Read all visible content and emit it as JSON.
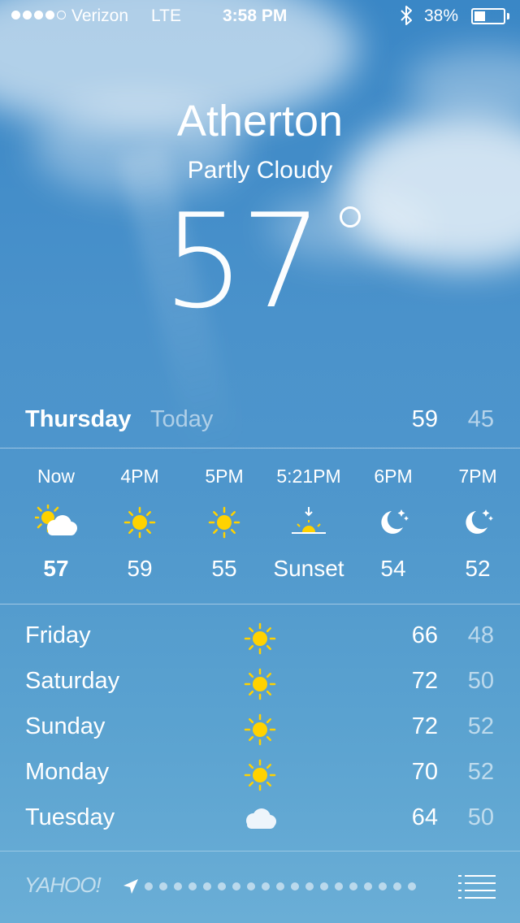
{
  "status_bar": {
    "carrier": "Verizon",
    "network": "LTE",
    "time": "3:58 PM",
    "battery_percent": "38%",
    "battery_level": 0.38,
    "signal_bars_filled": 4,
    "signal_bars_total": 5,
    "bluetooth_icon": "bluetooth-icon"
  },
  "current": {
    "city": "Atherton",
    "condition": "Partly Cloudy",
    "temperature": "57"
  },
  "today": {
    "day": "Thursday",
    "label": "Today",
    "high": "59",
    "low": "45"
  },
  "hourly": [
    {
      "time": "Now",
      "icon": "partly-cloudy-day-icon",
      "temp": "57"
    },
    {
      "time": "4PM",
      "icon": "sunny-icon",
      "temp": "59"
    },
    {
      "time": "5PM",
      "icon": "sunny-icon",
      "temp": "55"
    },
    {
      "time": "5:21PM",
      "icon": "sunset-icon",
      "temp": "Sunset"
    },
    {
      "time": "6PM",
      "icon": "clear-night-icon",
      "temp": "54"
    },
    {
      "time": "7PM",
      "icon": "clear-night-icon",
      "temp": "52"
    }
  ],
  "daily": [
    {
      "day": "Friday",
      "icon": "sunny-icon",
      "high": "66",
      "low": "48"
    },
    {
      "day": "Saturday",
      "icon": "sunny-icon",
      "high": "72",
      "low": "50"
    },
    {
      "day": "Sunday",
      "icon": "sunny-icon",
      "high": "72",
      "low": "52"
    },
    {
      "day": "Monday",
      "icon": "sunny-icon",
      "high": "70",
      "low": "52"
    },
    {
      "day": "Tuesday",
      "icon": "cloudy-icon",
      "high": "64",
      "low": "50"
    }
  ],
  "footer": {
    "brand": "YAHOO!",
    "page_count": 19,
    "location_icon": "location-arrow-icon",
    "list_icon": "list-icon"
  },
  "colors": {
    "sun": "#ffd200",
    "sky_top": "#3a87c6",
    "sky_bottom": "#6aaed6"
  }
}
